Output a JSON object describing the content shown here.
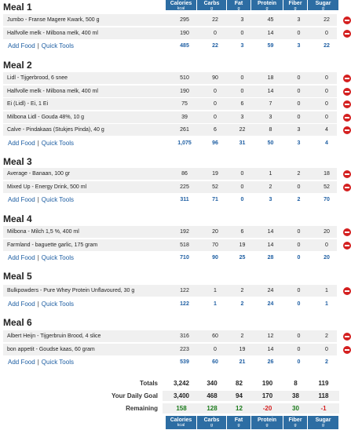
{
  "columns": [
    {
      "label": "Calories",
      "unit": "kcal"
    },
    {
      "label": "Carbs",
      "unit": "g"
    },
    {
      "label": "Fat",
      "unit": "g"
    },
    {
      "label": "Protein",
      "unit": "g"
    },
    {
      "label": "Fiber",
      "unit": "g"
    },
    {
      "label": "Sugar",
      "unit": "g"
    }
  ],
  "add_food_label": "Add Food",
  "separator": "|",
  "quick_tools_label": "Quick Tools",
  "meals": [
    {
      "title": "Meal 1",
      "foods": [
        {
          "name": "Jumbo - Franse Magere Kwark, 500 g",
          "cal": "295",
          "carbs": "22",
          "fat": "3",
          "protein": "45",
          "fiber": "3",
          "sugar": "22"
        },
        {
          "name": "Halfvolle melk - Milbona melk, 400 ml",
          "cal": "190",
          "carbs": "0",
          "fat": "0",
          "protein": "14",
          "fiber": "0",
          "sugar": "0"
        }
      ],
      "totals": {
        "cal": "485",
        "carbs": "22",
        "fat": "3",
        "protein": "59",
        "fiber": "3",
        "sugar": "22"
      }
    },
    {
      "title": "Meal 2",
      "foods": [
        {
          "name": "Lidl - Tijgerbrood, 6 snee",
          "cal": "510",
          "carbs": "90",
          "fat": "0",
          "protein": "18",
          "fiber": "0",
          "sugar": "0"
        },
        {
          "name": "Halfvolle melk - Milbona melk, 400 ml",
          "cal": "190",
          "carbs": "0",
          "fat": "0",
          "protein": "14",
          "fiber": "0",
          "sugar": "0"
        },
        {
          "name": "Ei (Lidl) - Ei, 1 Ei",
          "cal": "75",
          "carbs": "0",
          "fat": "6",
          "protein": "7",
          "fiber": "0",
          "sugar": "0"
        },
        {
          "name": "Milbona Lidl - Gouda 48%, 10 g",
          "cal": "39",
          "carbs": "0",
          "fat": "3",
          "protein": "3",
          "fiber": "0",
          "sugar": "0"
        },
        {
          "name": "Calve - Pindakaas (Stukjes Pinda), 40 g",
          "cal": "261",
          "carbs": "6",
          "fat": "22",
          "protein": "8",
          "fiber": "3",
          "sugar": "4"
        }
      ],
      "totals": {
        "cal": "1,075",
        "carbs": "96",
        "fat": "31",
        "protein": "50",
        "fiber": "3",
        "sugar": "4"
      }
    },
    {
      "title": "Meal 3",
      "foods": [
        {
          "name": "Average - Banaan, 100 gr",
          "cal": "86",
          "carbs": "19",
          "fat": "0",
          "protein": "1",
          "fiber": "2",
          "sugar": "18"
        },
        {
          "name": "Mixed Up - Energy Drink, 500 ml",
          "cal": "225",
          "carbs": "52",
          "fat": "0",
          "protein": "2",
          "fiber": "0",
          "sugar": "52"
        }
      ],
      "totals": {
        "cal": "311",
        "carbs": "71",
        "fat": "0",
        "protein": "3",
        "fiber": "2",
        "sugar": "70"
      }
    },
    {
      "title": "Meal 4",
      "foods": [
        {
          "name": "Milbona - Milch 1,5 %, 400 ml",
          "cal": "192",
          "carbs": "20",
          "fat": "6",
          "protein": "14",
          "fiber": "0",
          "sugar": "20"
        },
        {
          "name": "Farmland - baguette garlic, 175 gram",
          "cal": "518",
          "carbs": "70",
          "fat": "19",
          "protein": "14",
          "fiber": "0",
          "sugar": "0"
        }
      ],
      "totals": {
        "cal": "710",
        "carbs": "90",
        "fat": "25",
        "protein": "28",
        "fiber": "0",
        "sugar": "20"
      }
    },
    {
      "title": "Meal 5",
      "foods": [
        {
          "name": "Bulkpowders - Pure Whey Protein Unflavoured, 30 g",
          "cal": "122",
          "carbs": "1",
          "fat": "2",
          "protein": "24",
          "fiber": "0",
          "sugar": "1"
        }
      ],
      "totals": {
        "cal": "122",
        "carbs": "1",
        "fat": "2",
        "protein": "24",
        "fiber": "0",
        "sugar": "1"
      }
    },
    {
      "title": "Meal 6",
      "foods": [
        {
          "name": "Albert Heijn - Tijgerbruin Brood, 4 slice",
          "cal": "316",
          "carbs": "60",
          "fat": "2",
          "protein": "12",
          "fiber": "0",
          "sugar": "2"
        },
        {
          "name": "bon appetit - Goudse kaas, 60 gram",
          "cal": "223",
          "carbs": "0",
          "fat": "19",
          "protein": "14",
          "fiber": "0",
          "sugar": "0"
        }
      ],
      "totals": {
        "cal": "539",
        "carbs": "60",
        "fat": "21",
        "protein": "26",
        "fiber": "0",
        "sugar": "2"
      }
    }
  ],
  "summary": [
    {
      "label": "Totals",
      "cal": "3,242",
      "carbs": "340",
      "fat": "82",
      "protein": "190",
      "fiber": "8",
      "sugar": "119"
    },
    {
      "label": "Your Daily Goal",
      "cal": "3,400",
      "carbs": "468",
      "fat": "94",
      "protein": "170",
      "fiber": "38",
      "sugar": "118"
    },
    {
      "label": "Remaining",
      "cal": "158",
      "carbs": "128",
      "fat": "12",
      "protein": "-20",
      "fiber": "30",
      "sugar": "-1"
    }
  ],
  "colors": {
    "header_bg": "#2d6da3",
    "link": "#1f5fa3",
    "delete": "#d42020",
    "negative": "#d42020",
    "positive": "#1a7a1a",
    "row_bg": "#f0f0f0"
  },
  "icons": {
    "delete": "remove-circle-icon"
  }
}
